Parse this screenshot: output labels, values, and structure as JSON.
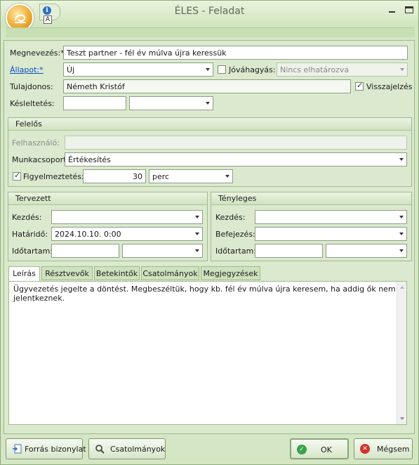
{
  "window": {
    "title": "ÉLES - Feladat"
  },
  "form": {
    "name_label": "Megnevezés:*",
    "name_value": "Teszt partner - fél év múlva újra keressük",
    "status_label": "Állapot:*",
    "status_value": "Új",
    "approval_label": "Jóváhagyás:",
    "approval_value": "Nincs elhatározva",
    "owner_label": "Tulajdonos:",
    "owner_value": "Németh Kristóf",
    "feedback_label": "Visszajelzés",
    "delay_label": "Késleltetés:",
    "delay_value": "",
    "delay_unit": ""
  },
  "responsible": {
    "header": "Felelős",
    "user_label": "Felhasználó:",
    "user_value": "",
    "workgroup_label": "Munkacsoport:",
    "workgroup_value": "Értékesítés",
    "alert_label": "Figyelmeztetés:",
    "alert_value": "30",
    "alert_unit": "perc"
  },
  "planned": {
    "header": "Tervezett",
    "start_label": "Kezdés:",
    "start_value": "",
    "deadline_label": "Határidő:",
    "deadline_value": "2024.10.10. 0:00",
    "duration_label": "Időtartam:",
    "duration_value": "",
    "duration_unit": ""
  },
  "actual": {
    "header": "Tényleges",
    "start_label": "Kezdés:",
    "start_value": "",
    "end_label": "Befejezés:",
    "end_value": "",
    "duration_label": "Időtartam:",
    "duration_value": "",
    "duration_unit": ""
  },
  "tabs": [
    {
      "label": "Leírás"
    },
    {
      "label": "Résztvevők"
    },
    {
      "label": "Betekintők"
    },
    {
      "label": "Csatolmányok"
    },
    {
      "label": "Megjegyzések"
    }
  ],
  "description": "Ügyvezetés jegelte a döntést. Megbeszéltük, hogy kb. fél év múlva újra keresem, ha addig ők nem jelentkeznek.",
  "buttons": {
    "source": "Forrás bizonylat",
    "attachments": "Csatolmányok",
    "ok": "OK",
    "cancel": "Mégsem"
  }
}
